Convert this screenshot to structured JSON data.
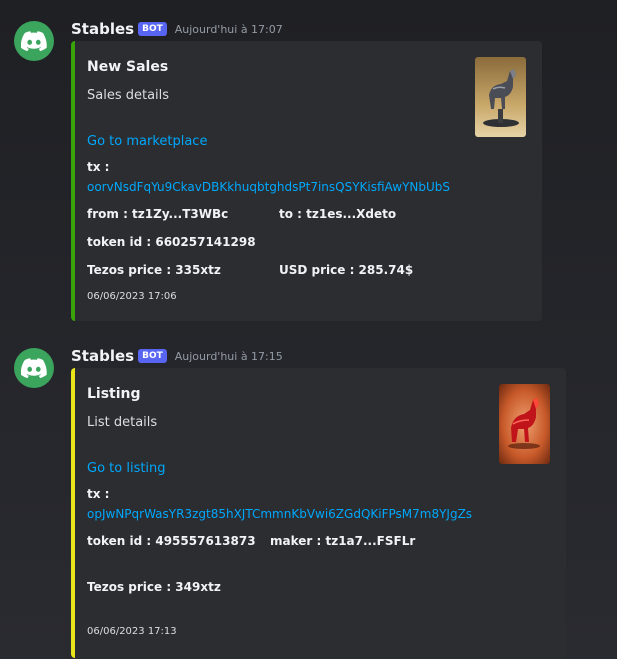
{
  "messages": [
    {
      "username": "Stables",
      "bot_tag": "BOT",
      "timestamp": "Aujourd'hui à 17:07",
      "accent": "#3ba30a",
      "title": "New Sales",
      "description": "Sales details",
      "link": "Go to marketplace",
      "tx_label": "tx :",
      "tx_hash": "oorvNsdFqYu9CkavDBKkhuqbtghdsPt7insQSYKisfiAwYNbUbS",
      "from": "from : tz1Zy...T3WBc",
      "to": "to : tz1es...Xdeto",
      "token_id": "token id : 660257141298",
      "tezos_price": "Tezos price : 335xtz",
      "usd_price": "USD price : 285.74$",
      "footer": "06/06/2023 17:06",
      "thumbnail_icon": "horse-statue-thumbnail"
    },
    {
      "username": "Stables",
      "bot_tag": "BOT",
      "timestamp": "Aujourd'hui à 17:15",
      "accent": "#e8e61a",
      "title": "Listing",
      "description": "List details",
      "link": "Go to listing",
      "tx_label": "tx :",
      "tx_hash": "opJwNPqrWasYR3zgt85hXJTCmmnKbVwi6ZGdQKiFPsM7m8YJgZs",
      "token_id": "token id : 495557613873",
      "maker": "maker : tz1a7...FSFLr",
      "tezos_price": "Tezos price : 349xtz",
      "footer": "06/06/2023 17:13",
      "thumbnail_icon": "red-horse-thumbnail"
    }
  ]
}
